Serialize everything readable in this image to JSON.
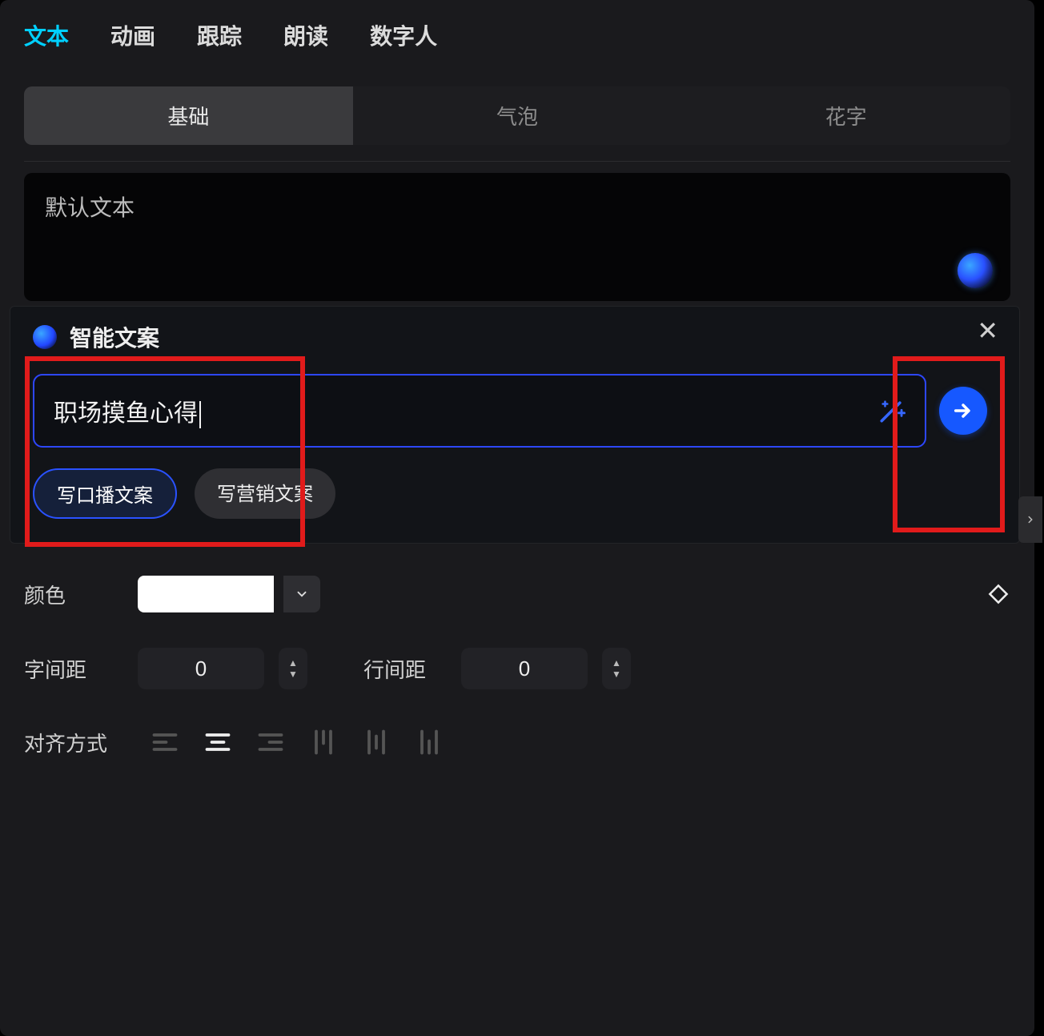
{
  "topTabs": {
    "items": [
      "文本",
      "动画",
      "跟踪",
      "朗读",
      "数字人"
    ],
    "activeIndex": 0
  },
  "subTabs": {
    "items": [
      "基础",
      "气泡",
      "花字"
    ],
    "activeIndex": 0
  },
  "textArea": {
    "placeholder": "默认文本"
  },
  "smartPanel": {
    "title": "智能文案",
    "inputValue": "职场摸鱼心得",
    "chips": [
      "写口播文案",
      "写营销文案"
    ],
    "chipActive": 0
  },
  "props": {
    "colorLabel": "颜色",
    "colorValue": "#ffffff",
    "letterSpacingLabel": "字间距",
    "letterSpacingValue": "0",
    "lineSpacingLabel": "行间距",
    "lineSpacingValue": "0",
    "alignLabel": "对齐方式",
    "alignActive": 1
  }
}
